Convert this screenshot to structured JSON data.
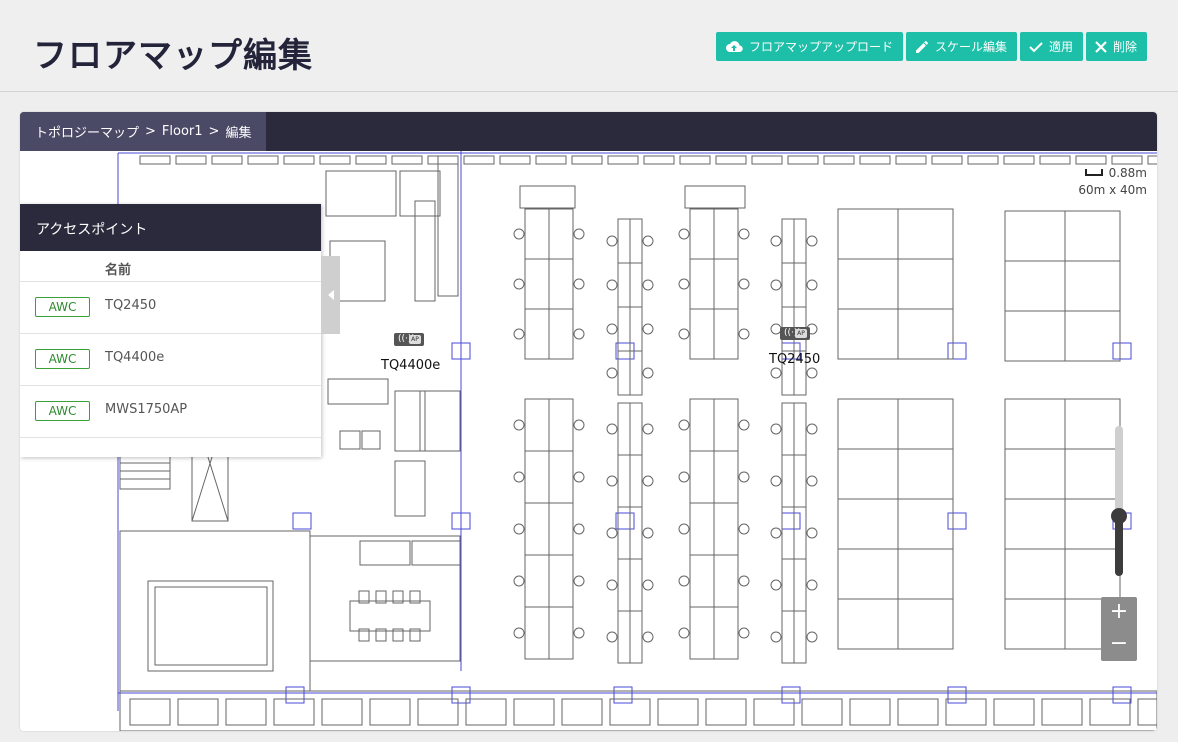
{
  "header": {
    "title": "フロアマップ編集"
  },
  "toolbar": {
    "upload_label": "フロアマップアップロード",
    "scale_label": "スケール編集",
    "apply_label": "適用",
    "delete_label": "削除"
  },
  "breadcrumb": {
    "items": [
      "トポロジーマップ",
      "Floor1",
      "編集"
    ],
    "separator": ">"
  },
  "ap_panel": {
    "title": "アクセスポイント",
    "column_name": "名前",
    "rows": [
      {
        "badge": "AWC",
        "name": "TQ2450"
      },
      {
        "badge": "AWC",
        "name": "TQ4400e"
      },
      {
        "badge": "AWC",
        "name": "MWS1750AP"
      }
    ]
  },
  "map": {
    "scale_value": "0.88m",
    "dimensions": "60m x 40m",
    "ap_marker_tag": "AP",
    "placed_aps": [
      {
        "name": "TQ4400e"
      },
      {
        "name": "TQ2450"
      }
    ],
    "zoom_level": 0.4,
    "zoom_in": "+",
    "zoom_out": "−"
  },
  "colors": {
    "accent": "#1ebfa8",
    "header_dark": "#2a2a3c",
    "breadcrumb_bg": "#4a4a66",
    "badge_green": "#3aa03a",
    "wall_blue": "#4a4ad8"
  }
}
